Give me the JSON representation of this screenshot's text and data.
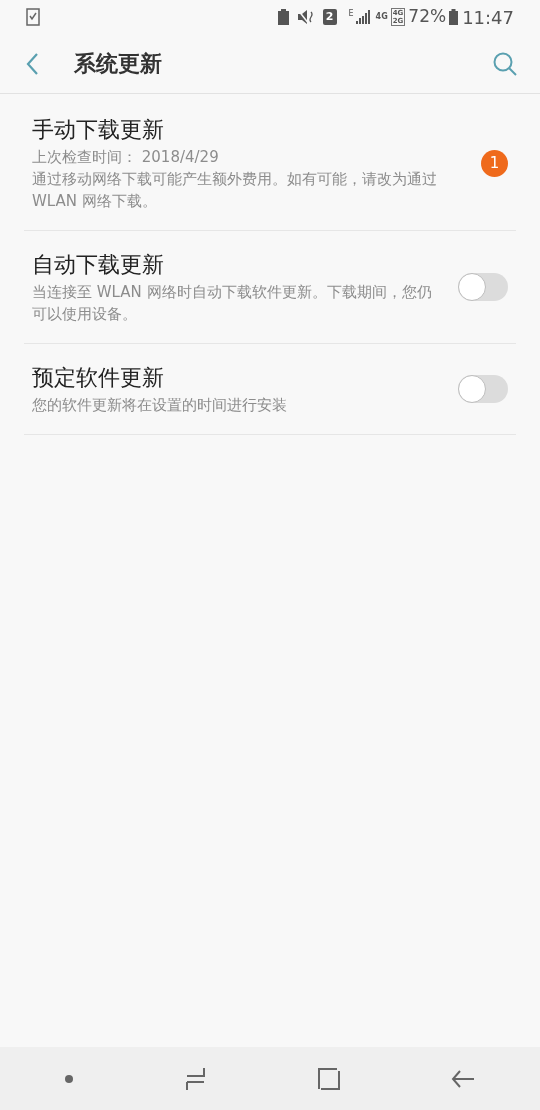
{
  "status_bar": {
    "sim": "2",
    "network": "E",
    "data": "4G",
    "dual": [
      "4G",
      "2G"
    ],
    "battery": "72%",
    "time": "11:47"
  },
  "header": {
    "title": "系统更新"
  },
  "items": [
    {
      "kind": "badge",
      "title": "手动下载更新",
      "lines": [
        "上次检查时间： 2018/4/29",
        "通过移动网络下载可能产生额外费用。如有可能，请改为通过 WLAN 网络下载。"
      ],
      "badge": "1"
    },
    {
      "kind": "switch",
      "title": "自动下载更新",
      "lines": [
        "当连接至 WLAN 网络时自动下载软件更新。下载期间，您仍可以使用设备。"
      ],
      "on": false
    },
    {
      "kind": "switch",
      "title": "预定软件更新",
      "lines": [
        "您的软件更新将在设置的时间进行安装"
      ],
      "on": false
    }
  ]
}
